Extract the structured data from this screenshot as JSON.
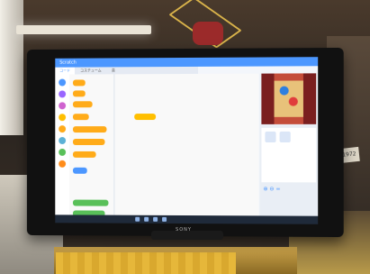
{
  "scene": {
    "description_visible_text": "",
    "tv_brand": "SONY",
    "price_tag": "1972"
  },
  "scratch": {
    "menu_label": "Scratch",
    "tabs": [
      {
        "label": "コード"
      },
      {
        "label": "コスチューム"
      },
      {
        "label": "音"
      }
    ],
    "accent": "#4c97ff"
  },
  "colors": {
    "tv_bezel": "#111111",
    "menu_bar": "#4c97ff",
    "block_orange": "#ffab19",
    "block_blue": "#4c97ff",
    "block_green": "#59c059"
  }
}
